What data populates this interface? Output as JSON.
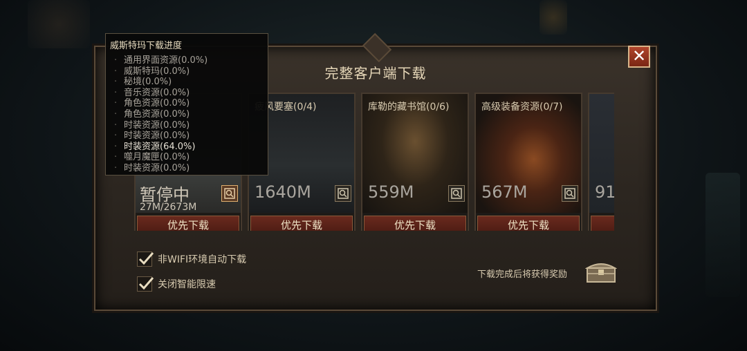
{
  "dialog": {
    "title": "完整客户端下载",
    "close_label": "✕"
  },
  "cards": [
    {
      "name": "",
      "paused_label": "暂停中",
      "progress": "27M/2673M",
      "button": "优先下载"
    },
    {
      "name": "疲风要塞(0/4)",
      "size": "1640M",
      "button": "优先下载"
    },
    {
      "name": "库勒的藏书馆(0/6)",
      "size": "559M",
      "button": "优先下载"
    },
    {
      "name": "高级装备资源(0/7)",
      "size": "567M",
      "button": "优先下载"
    },
    {
      "name": "",
      "size": "91",
      "button": ""
    }
  ],
  "options": {
    "auto_download": "非WIFI环境自动下载",
    "smart_limit": "关闭智能限速"
  },
  "reward_text": "下载完成后将获得奖励",
  "tooltip": {
    "title": "威斯特玛下载进度",
    "items": [
      "通用界面资源(0.0%)",
      "威斯特玛(0.0%)",
      "秘境(0.0%)",
      "音乐资源(0.0%)",
      "角色资源(0.0%)",
      "角色资源(0.0%)",
      "时装资源(0.0%)",
      "时装资源(0.0%)",
      "时装资源(64.0%)",
      "噬月魔匣(0.0%)",
      "时装资源(0.0%)"
    ]
  },
  "colors": {
    "accent": "#6a2a1e",
    "frame": "#5a4a38"
  }
}
